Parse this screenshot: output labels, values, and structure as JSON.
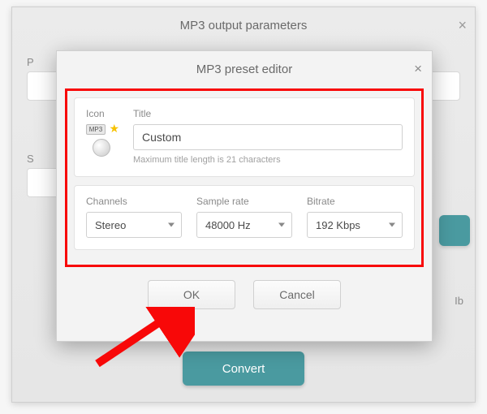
{
  "outer": {
    "title": "MP3 output parameters",
    "partial_label_1": "P",
    "partial_label_2": "S",
    "unit_suffix": "Ib",
    "convert_label": "Convert"
  },
  "dialog": {
    "title": "MP3 preset editor",
    "icon_label": "Icon",
    "icon_badge": "MP3",
    "title_field": {
      "label": "Title",
      "value": "Custom",
      "hint": "Maximum title length is 21 characters"
    },
    "channels": {
      "label": "Channels",
      "value": "Stereo"
    },
    "sample_rate": {
      "label": "Sample rate",
      "value": "48000 Hz"
    },
    "bitrate": {
      "label": "Bitrate",
      "value": "192 Kbps"
    },
    "ok_label": "OK",
    "cancel_label": "Cancel"
  }
}
